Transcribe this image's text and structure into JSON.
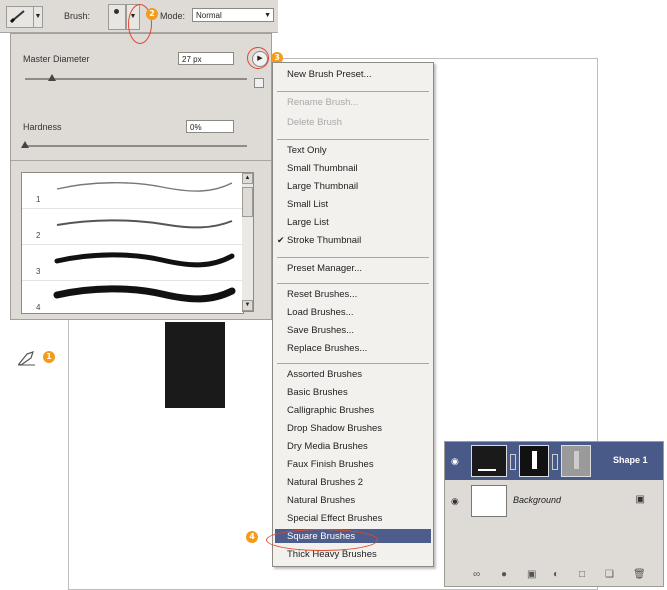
{
  "options_bar": {
    "brush_label": "Brush:",
    "mode_label": "Mode:",
    "mode_value": "Normal"
  },
  "brush_picker": {
    "master_diameter_label": "Master Diameter",
    "master_diameter_value": "27 px",
    "master_diameter_level": 0.12,
    "hardness_label": "Hardness",
    "hardness_value": "0%",
    "hardness_level": 0.0,
    "brushes": [
      {
        "number": "1"
      },
      {
        "number": "2"
      },
      {
        "number": "3"
      },
      {
        "number": "4"
      }
    ]
  },
  "callouts": [
    "1",
    "2",
    "3",
    "4"
  ],
  "menu": {
    "items": [
      {
        "label": "New Brush Preset...",
        "disabled": false
      },
      {
        "label": "Rename Brush...",
        "disabled": true
      },
      {
        "label": "Delete Brush",
        "disabled": true
      },
      {
        "label": "Text Only",
        "disabled": false
      },
      {
        "label": "Small Thumbnail",
        "disabled": false
      },
      {
        "label": "Large Thumbnail",
        "disabled": false
      },
      {
        "label": "Small List",
        "disabled": false
      },
      {
        "label": "Large List",
        "disabled": false
      },
      {
        "label": "Stroke Thumbnail",
        "disabled": false,
        "checked": true
      },
      {
        "label": "Preset Manager...",
        "disabled": false
      },
      {
        "label": "Reset Brushes...",
        "disabled": false
      },
      {
        "label": "Load Brushes...",
        "disabled": false
      },
      {
        "label": "Save Brushes...",
        "disabled": false
      },
      {
        "label": "Replace Brushes...",
        "disabled": false
      },
      {
        "label": "Assorted Brushes",
        "disabled": false
      },
      {
        "label": "Basic Brushes",
        "disabled": false
      },
      {
        "label": "Calligraphic Brushes",
        "disabled": false
      },
      {
        "label": "Drop Shadow Brushes",
        "disabled": false
      },
      {
        "label": "Dry Media Brushes",
        "disabled": false
      },
      {
        "label": "Faux Finish Brushes",
        "disabled": false
      },
      {
        "label": "Natural Brushes 2",
        "disabled": false
      },
      {
        "label": "Natural Brushes",
        "disabled": false
      },
      {
        "label": "Special Effect Brushes",
        "disabled": false
      },
      {
        "label": "Square Brushes",
        "disabled": false,
        "highlighted": true
      },
      {
        "label": "Thick Heavy Brushes",
        "disabled": false
      }
    ]
  },
  "layers": {
    "rows": [
      {
        "name": "Shape 1",
        "selected": true
      },
      {
        "name": "Background",
        "selected": false
      }
    ]
  },
  "colors": {
    "panel": "#dedbd6",
    "highlight": "#4d5d8c",
    "callout": "#f29b1c",
    "ring": "#e3462c",
    "shape": "#1b1a1b"
  }
}
